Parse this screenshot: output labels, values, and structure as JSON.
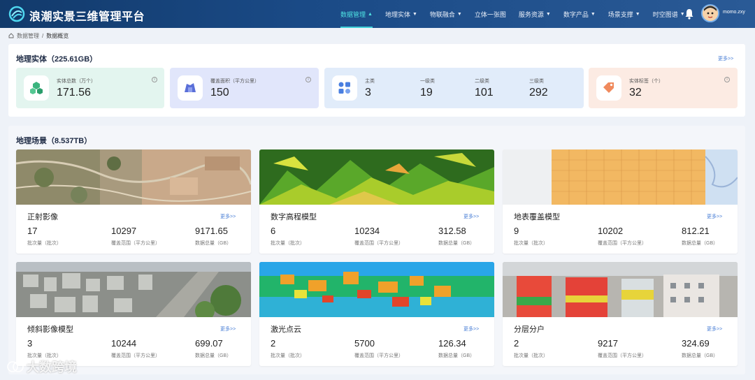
{
  "header": {
    "app_title": "浪潮实景三维管理平台",
    "nav": [
      {
        "label": "数据管理",
        "caret": "▲"
      },
      {
        "label": "地理实体",
        "caret": "▼"
      },
      {
        "label": "物联融合",
        "caret": "▼"
      },
      {
        "label": "立体一张图",
        "caret": ""
      },
      {
        "label": "服务资源",
        "caret": "▼"
      },
      {
        "label": "数字产品",
        "caret": "▼"
      },
      {
        "label": "场景支撑",
        "caret": "▼"
      },
      {
        "label": "时空图谱",
        "caret": "▼"
      }
    ],
    "username": "momo.zxy"
  },
  "breadcrumb": {
    "root": "数据管理",
    "separator": "/",
    "current": "数据概览"
  },
  "entity_section": {
    "title": "地理实体（225.61GB）",
    "more": "更多>>",
    "cards": {
      "total": {
        "label": "实体总数（万个）",
        "value": "171.56",
        "info": "i"
      },
      "area": {
        "label": "覆盖面积（平方公里）",
        "value": "150",
        "info": "i"
      },
      "classes": [
        {
          "label": "主类",
          "value": "3"
        },
        {
          "label": "一级类",
          "value": "19"
        },
        {
          "label": "二级类",
          "value": "101"
        },
        {
          "label": "三级类",
          "value": "292"
        }
      ],
      "tags": {
        "label": "实体标签（个）",
        "value": "32",
        "info": "i"
      }
    }
  },
  "scene_section": {
    "title": "地理场景（8.537TB）",
    "more_label": "更多>>",
    "labels": {
      "batches": "批次量（批次）",
      "area": "覆盖范围（平方公里）",
      "size": "数据总量（GB）"
    },
    "cards": [
      {
        "name": "正射影像",
        "batches": "17",
        "area": "10297",
        "size": "9171.65"
      },
      {
        "name": "数字高程模型",
        "batches": "6",
        "area": "10234",
        "size": "312.58"
      },
      {
        "name": "地表覆盖模型",
        "batches": "9",
        "area": "10202",
        "size": "812.21"
      },
      {
        "name": "倾斜影像模型",
        "batches": "3",
        "area": "10244",
        "size": "699.07"
      },
      {
        "name": "激光点云",
        "batches": "2",
        "area": "5700",
        "size": "126.34"
      },
      {
        "name": "分层分户",
        "batches": "2",
        "area": "9217",
        "size": "324.69"
      }
    ]
  },
  "watermark": "大数跨境",
  "colors": {
    "accent": "#3fd0d8",
    "header": "#1a4a86",
    "link": "#4a7fd6"
  }
}
